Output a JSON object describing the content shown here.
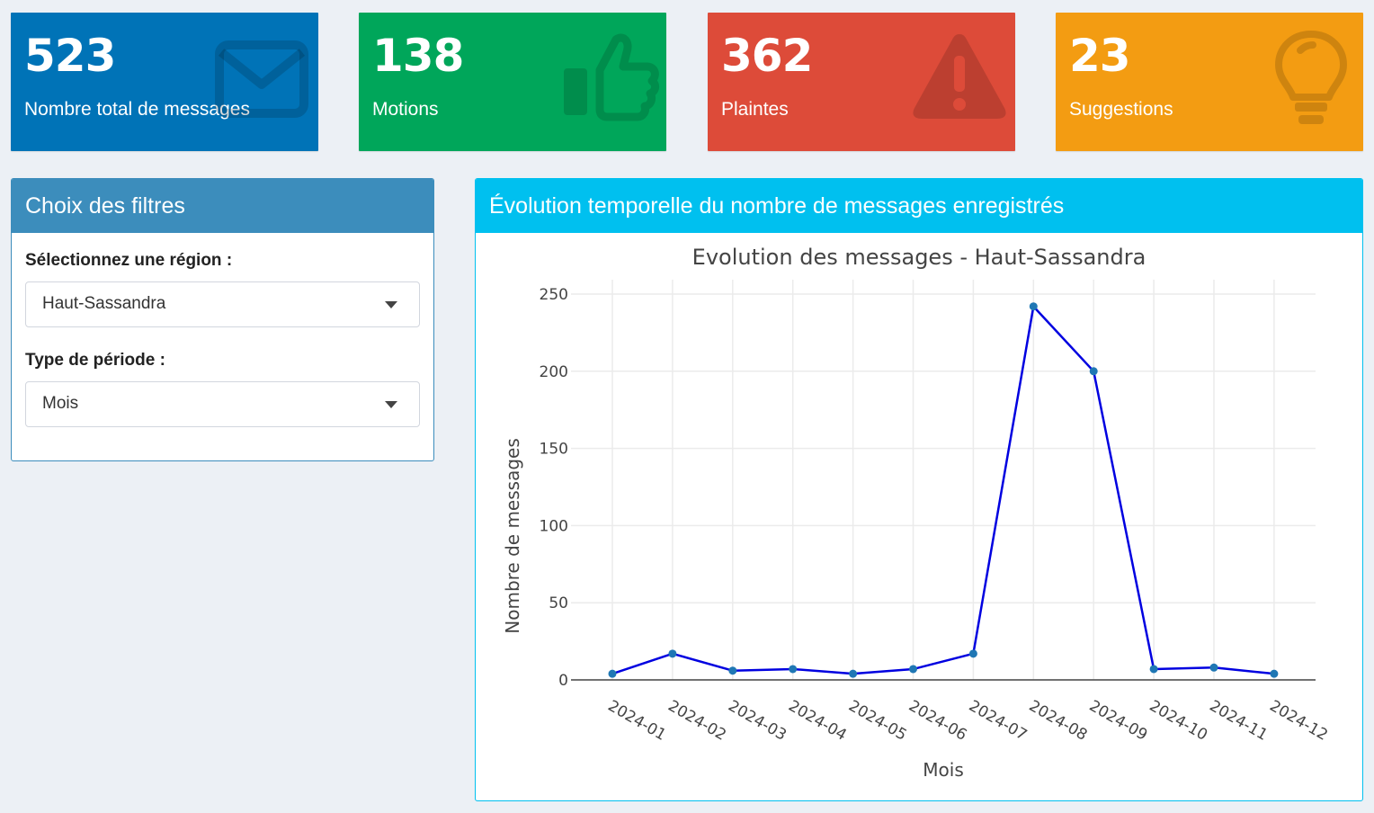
{
  "stats": [
    {
      "value": "523",
      "label": "Nombre total de messages",
      "color": "#0073b7",
      "icon": "envelope-icon"
    },
    {
      "value": "138",
      "label": "Motions",
      "color": "#00a65a",
      "icon": "thumbs-up-icon"
    },
    {
      "value": "362",
      "label": "Plaintes",
      "color": "#dd4b39",
      "icon": "warning-icon"
    },
    {
      "value": "23",
      "label": "Suggestions",
      "color": "#f39c12",
      "icon": "lightbulb-icon"
    }
  ],
  "filters": {
    "title": "Choix des filtres",
    "header_color": "#3c8dbc",
    "region_label": "Sélectionnez une région :",
    "region_value": "Haut-Sassandra",
    "period_label": "Type de période :",
    "period_value": "Mois"
  },
  "chart_panel": {
    "title": "Évolution temporelle du nombre de messages enregistrés",
    "header_color": "#00c0ef"
  },
  "chart_data": {
    "type": "line",
    "title": "Evolution des messages - Haut-Sassandra",
    "xlabel": "Mois",
    "ylabel": "Nombre de messages",
    "categories": [
      "2024-01",
      "2024-02",
      "2024-03",
      "2024-04",
      "2024-05",
      "2024-06",
      "2024-07",
      "2024-08",
      "2024-09",
      "2024-10",
      "2024-11",
      "2024-12"
    ],
    "values": [
      4,
      17,
      6,
      7,
      4,
      7,
      17,
      242,
      200,
      7,
      8,
      4
    ],
    "yticks": [
      0,
      50,
      100,
      150,
      200,
      250
    ],
    "ylim": [
      0,
      250
    ],
    "line_color": "#0000e0",
    "marker_color": "#1f77b4",
    "grid": true
  }
}
